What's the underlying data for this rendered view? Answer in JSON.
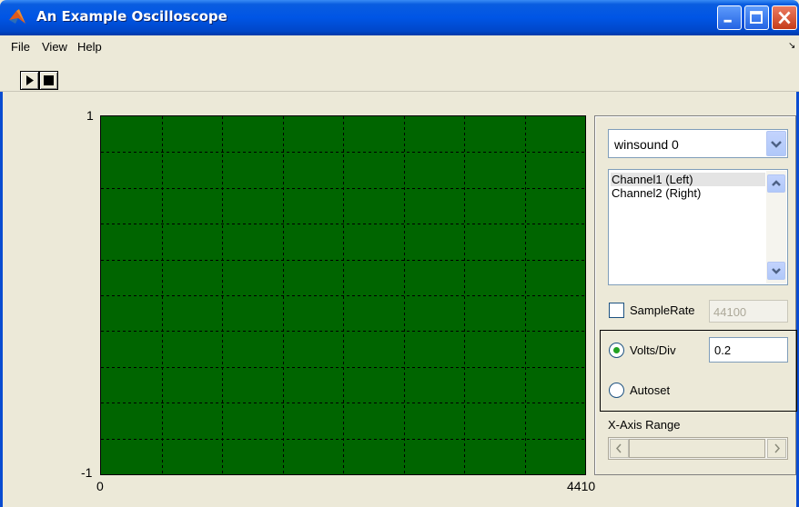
{
  "window": {
    "title": "An Example Oscilloscope",
    "title_color": "#0055e5"
  },
  "menu": {
    "items": [
      "File",
      "View",
      "Help"
    ],
    "overflow_glyph": "↘"
  },
  "toolbar": {
    "play_icon": "play-icon",
    "stop_icon": "stop-icon"
  },
  "plot": {
    "y_max_label": "1",
    "y_min_label": "-1",
    "x_min_label": "0",
    "x_max_label": "4410",
    "background": "#006500",
    "grid_style": "dashed",
    "grid_divisions": {
      "x": 8,
      "y": 10
    }
  },
  "controls": {
    "device": {
      "selected": "winsound 0"
    },
    "channels": [
      "Channel1 (Left)",
      "Channel2 (Right)"
    ],
    "selected_channel": "Channel1 (Left)",
    "sample_rate": {
      "label": "SampleRate",
      "value": "44100",
      "checked": false
    },
    "volts_div": {
      "label": "Volts/Div",
      "value": "0.2",
      "selected": true
    },
    "autoset": {
      "label": "Autoset",
      "selected": false
    },
    "x_axis_range": {
      "label": "X-Axis Range"
    }
  }
}
